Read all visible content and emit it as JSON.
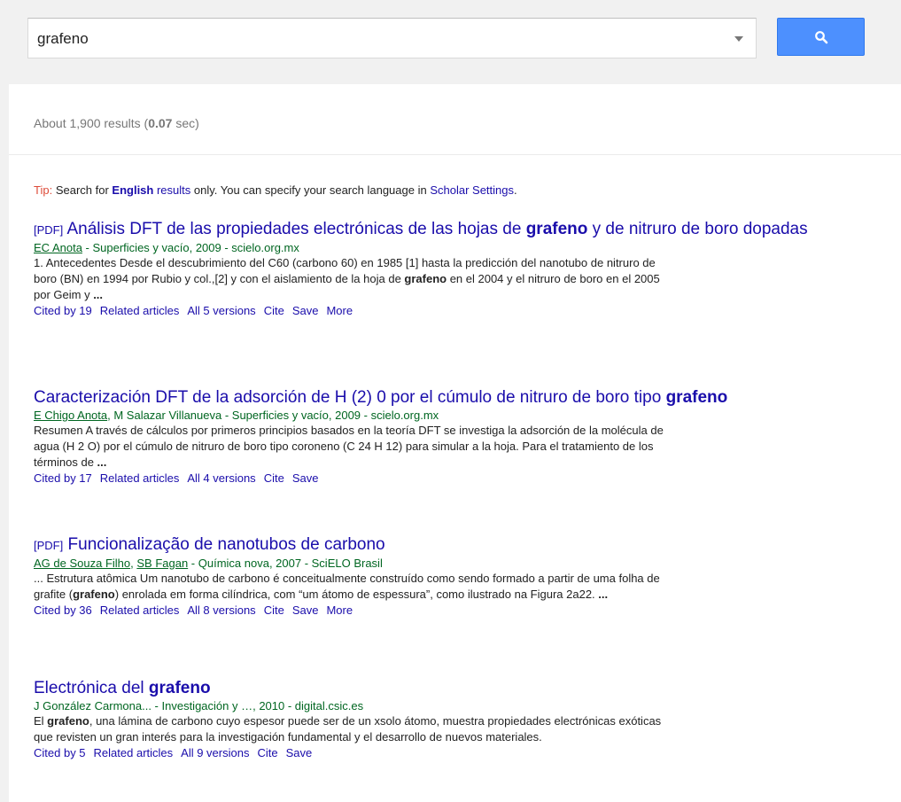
{
  "search": {
    "query": "grafeno",
    "button_icon": "search-icon"
  },
  "stats": {
    "prefix": "About 1,900 results (",
    "time": "0.07",
    "suffix": " sec)"
  },
  "tip": {
    "label": "Tip:",
    "text1": " Search for ",
    "english": "English",
    "text2": " results",
    "text3": " only. You can specify your search language in ",
    "settings": "Scholar Settings",
    "text4": "."
  },
  "results": [
    {
      "pdf": "[PDF]",
      "title_parts": [
        "Análisis DFT de las propiedades electrónicas de las hojas de ",
        "grafeno",
        " y de nitruro de boro dopadas"
      ],
      "authors": [
        "EC Anota"
      ],
      "meta": " - Superficies y vacío, 2009 - scielo.org.mx",
      "snippet_parts": [
        "1. Antecedentes Desde el descubrimiento del C60 (carbono 60) en 1985 [1] hasta la predicción del nanotubo de nitruro de boro (BN) en 1994 por Rubio y col.,[2] y con el aislamiento de la hoja de ",
        "grafeno",
        " en el 2004 y el nitruro de boro en el 2005 por Geim y ",
        "..."
      ],
      "links": [
        "Cited by 19",
        "Related articles",
        "All 5 versions",
        "Cite",
        "Save",
        "More"
      ]
    },
    {
      "pdf": "",
      "title_parts": [
        "Caracterización DFT de la adsorción de H (2) 0 por el cúmulo de nitruro de boro tipo ",
        "grafeno",
        ""
      ],
      "authors": [
        "E Chigo Anota"
      ],
      "meta": ", M Salazar Villanueva - Superficies y vacío, 2009 - scielo.org.mx",
      "snippet_parts": [
        "Resumen A través de cálculos por primeros principios basados en la teoría DFT se investiga la adsorción de la molécula de agua (H 2 O) por el cúmulo de nitruro de boro tipo coroneno (C 24 H 12) para simular a la hoja. Para el tratamiento de los términos de ",
        "...",
        ""
      ],
      "links": [
        "Cited by 17",
        "Related articles",
        "All 4 versions",
        "Cite",
        "Save"
      ]
    },
    {
      "pdf": "[PDF]",
      "title_parts": [
        "Funcionalização de nanotubos de carbono",
        "",
        ""
      ],
      "authors": [
        "AG de Souza Filho",
        "SB Fagan"
      ],
      "meta": " - Química nova, 2007 - SciELO Brasil",
      "snippet_parts": [
        "... Estrutura atômica Um nanotubo de carbono é conceitualmente construído como sendo formado a partir de uma folha de grafite (",
        "grafeno",
        ") enrolada em forma cilíndrica, com “um átomo de espessura”, como ilustrado na Figura 2a22. ",
        "..."
      ],
      "links": [
        "Cited by 36",
        "Related articles",
        "All 8 versions",
        "Cite",
        "Save",
        "More"
      ]
    },
    {
      "pdf": "",
      "title_parts": [
        "Electrónica del ",
        "grafeno",
        ""
      ],
      "authors": [],
      "meta": "J González Carmona... - Investigación y …, 2010 - digital.csic.es",
      "snippet_parts": [
        "El ",
        "grafeno",
        ", una lámina de carbono cuyo espesor puede ser de un xsolo átomo, muestra propiedades electrónicas exóticas que revisten un gran interés para la investigación fundamental y el desarrollo de nuevos materiales."
      ],
      "links": [
        "Cited by 5",
        "Related articles",
        "All 9 versions",
        "Cite",
        "Save"
      ]
    }
  ]
}
